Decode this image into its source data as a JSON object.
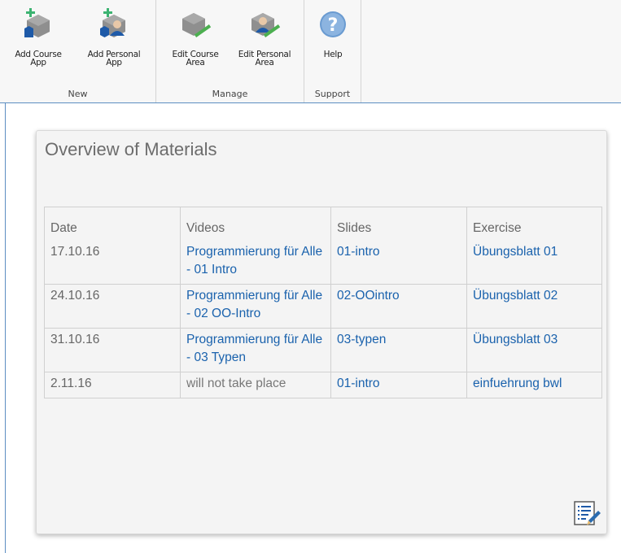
{
  "ribbon": {
    "groups": [
      {
        "label": "New",
        "buttons": [
          "Add Course\nApp",
          "Add Personal\nApp"
        ]
      },
      {
        "label": "Manage",
        "buttons": [
          "Edit Course\nArea",
          "Edit Personal\nArea"
        ]
      },
      {
        "label": "Support",
        "buttons": [
          "Help"
        ]
      }
    ],
    "colors": {
      "hex": "#909090",
      "plus": "#3cb371",
      "pencil": "#4caf50",
      "person": "#1e5aa8",
      "help": "#6a9bd1",
      "accent_line": "#5d8ec2"
    }
  },
  "card": {
    "title": "Overview of Materials",
    "table": {
      "headers": [
        "Date",
        "Videos",
        "Slides",
        "Exercise"
      ],
      "rows": [
        {
          "date": "17.10.16",
          "video": "Programmierung für Alle - 01 Intro",
          "slides": "01-intro",
          "exercise": "Übungsblatt 01"
        },
        {
          "date": "24.10.16",
          "video": "Programmierung für Alle - 02 OO-Intro",
          "slides": "02-OOintro",
          "exercise": "Übungsblatt 02"
        },
        {
          "date": "31.10.16",
          "video": "Programmierung für Alle - 03 Typen",
          "slides": "03-typen",
          "exercise": "Übungsblatt 03"
        },
        {
          "date": "2.11.16",
          "video": "will not take place",
          "slides": "01-intro",
          "exercise": "einfuehrung bwl"
        }
      ]
    },
    "edit_icon": "edit-content-icon"
  }
}
